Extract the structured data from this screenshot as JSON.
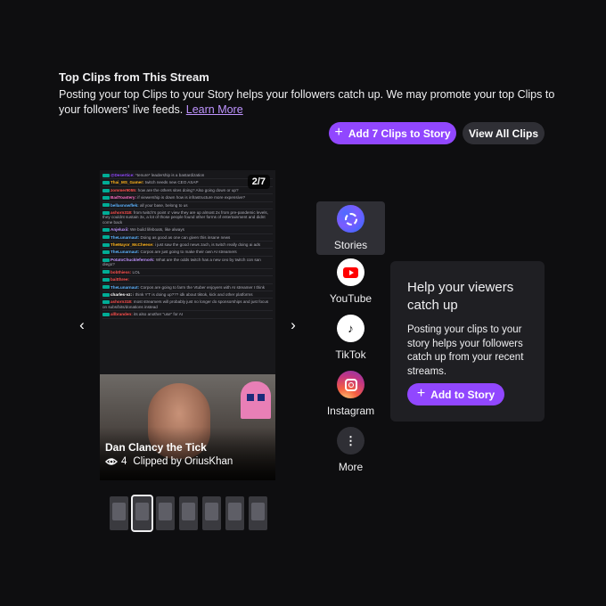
{
  "header": {
    "title": "Top Clips from This Stream",
    "description": "Posting your top Clips to your Story helps your followers catch up. We may promote your top Clips to your followers' live feeds.",
    "learn_more": "Learn More"
  },
  "actions": {
    "add_clips": "Add 7 Clips to Story",
    "view_all": "View All Clips",
    "plus_icon": "+"
  },
  "clip": {
    "counter": "2/7",
    "title": "Dan Clancy the Tick",
    "views": "4",
    "clipped_by": "Clipped by OriusKhan",
    "chat": [
      {
        "user": "@Desertice:",
        "color": "#9147ff",
        "text": "*tenure* leadership is a bastardization"
      },
      {
        "user": "Thai_MS_Gamer:",
        "color": "#ffb31a",
        "text": "twitch needs new CEO ASAP"
      },
      {
        "user": "zommer9055:",
        "color": "#ff4f4d",
        "text": "how are the others sites doing? Also going down or up?"
      },
      {
        "user": "BadToastery:",
        "color": "#ff6ec7",
        "text": "if viewership is down how is infrastructure more expensive?"
      },
      {
        "user": "bellasnowflek:",
        "color": "#5cb3ff",
        "text": "all your base, belong to us"
      },
      {
        "user": "ashorn318:",
        "color": "#ff4f4d",
        "text": "from twitch's point o' view they are up almost 2x from pre-pandemic levels, they couldnt sustain 3x, a lot of those people found other forms of entertainment and didnt come back"
      },
      {
        "user": "Anjeluxii:",
        "color": "#bf94ff",
        "text": "We build lifeboats, like always"
      },
      {
        "user": "TheLunarnaut:",
        "color": "#5cb3ff",
        "text": "Doing as good as one can given this insane news"
      },
      {
        "user": "TheMayor_McCheese:",
        "color": "#ffb31a",
        "text": "i just saw the good news zach, is twitch really doing ai ads"
      },
      {
        "user": "TheLunarnaut:",
        "color": "#5cb3ff",
        "text": "Corpos are just going to make their own AI streamers"
      },
      {
        "user": "PotatoChucklefernork:",
        "color": "#bf94ff",
        "text": "What are the odds twitch has a new ceo by twitch con san diego?"
      },
      {
        "user": "bobthiess:",
        "color": "#ff4f4d",
        "text": "LOL"
      },
      {
        "user": "baitthree:",
        "color": "#ff4f4d",
        "text": ""
      },
      {
        "user": "TheLunarnaut:",
        "color": "#5cb3ff",
        "text": "Corpos are going to farm the Vtuber enjoyers with AI streamer I think"
      },
      {
        "user": "charles-vz:",
        "color": "#ffffff",
        "text": "i think Y'T is doing up??? idk about tiktok, kick and other platforms"
      },
      {
        "user": "ashorn318:",
        "color": "#ff4f4d",
        "text": "most streamers will probably just no longer do sponsorships and just focus on subs/bits/donations instead"
      },
      {
        "user": "allbranden:",
        "color": "#ff4f4d",
        "text": "its also another \"use\" for AI"
      }
    ]
  },
  "thumbnails": 7,
  "active_thumbnail": 1,
  "platforms": [
    {
      "name": "stories",
      "label": "Stories",
      "icon": "stories-icon",
      "active": true
    },
    {
      "name": "youtube",
      "label": "YouTube",
      "icon": "youtube-icon",
      "active": false
    },
    {
      "name": "tiktok",
      "label": "TikTok",
      "icon": "tiktok-icon",
      "active": false
    },
    {
      "name": "instagram",
      "label": "Instagram",
      "icon": "instagram-icon",
      "active": false
    },
    {
      "name": "more",
      "label": "More",
      "icon": "more-icon",
      "active": false
    }
  ],
  "promo": {
    "title": "Help your viewers catch up",
    "body": "Posting your clips to your story helps your followers catch up from your recent streams.",
    "button": "Add to Story"
  },
  "colors": {
    "accent": "#9147ff",
    "background": "#0e0e10",
    "link": "#bf94ff"
  }
}
